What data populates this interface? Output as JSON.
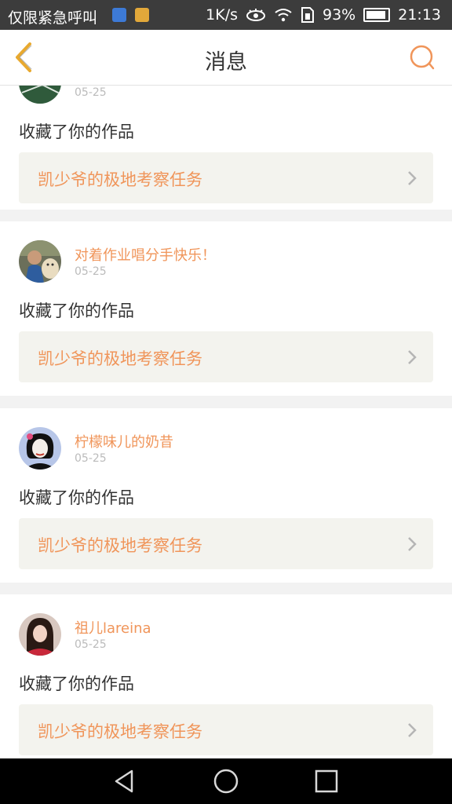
{
  "status_bar": {
    "carrier": "仅限紧急呼叫",
    "speed": "1K/s",
    "battery": "93%",
    "battery_level": 0.93,
    "time": "21:13"
  },
  "header": {
    "title": "消息",
    "back_icon": "chevron-left-icon",
    "search_icon": "search-icon"
  },
  "accent_color": "#f0955a",
  "messages": [
    {
      "user": "",
      "date": "05-25",
      "action": "收藏了你的作品",
      "work_title": "凯少爷的极地考察任务"
    },
    {
      "user": "对着作业唱分手快乐！",
      "date": "05-25",
      "action": "收藏了你的作品",
      "work_title": "凯少爷的极地考察任务"
    },
    {
      "user": "柠檬味儿的奶昔",
      "date": "05-25",
      "action": "收藏了你的作品",
      "work_title": "凯少爷的极地考察任务"
    },
    {
      "user": "祖儿lareina",
      "date": "05-25",
      "action": "收藏了你的作品",
      "work_title": "凯少爷的极地考察任务"
    }
  ],
  "system_nav": [
    "back-triangle-icon",
    "home-circle-icon",
    "recents-square-icon"
  ]
}
